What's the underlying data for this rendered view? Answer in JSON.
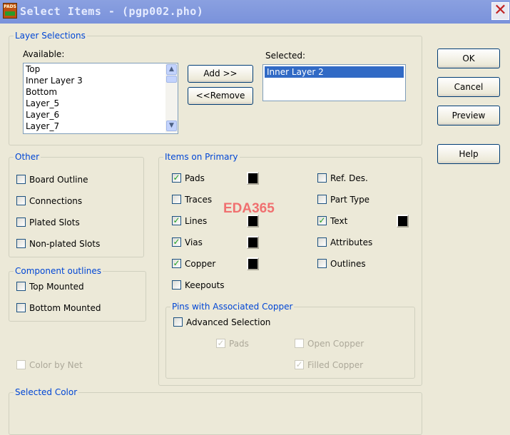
{
  "window": {
    "title": "Select Items - (pgp002.pho)",
    "icon_text": "PADS"
  },
  "layer_selections": {
    "legend": "Layer Selections",
    "available_label": "Available:",
    "selected_label": "Selected:",
    "available": [
      "Top",
      "Inner Layer 3",
      "Bottom",
      "Layer_5",
      "Layer_6",
      "Layer_7"
    ],
    "selected": [
      "Inner Layer 2"
    ],
    "add_label": "Add >>",
    "remove_label": "<<Remove"
  },
  "buttons": {
    "ok": "OK",
    "cancel": "Cancel",
    "preview": "Preview",
    "help": "Help"
  },
  "other": {
    "legend": "Other",
    "items": [
      {
        "label": "Board Outline",
        "checked": false
      },
      {
        "label": "Connections",
        "checked": false
      },
      {
        "label": "Plated Slots",
        "checked": false
      },
      {
        "label": "Non-plated Slots",
        "checked": false
      }
    ]
  },
  "component_outlines": {
    "legend": "Component outlines",
    "items": [
      {
        "label": "Top Mounted",
        "checked": false
      },
      {
        "label": "Bottom Mounted",
        "checked": false
      }
    ]
  },
  "color_by_net": {
    "label": "Color by Net",
    "checked": false,
    "disabled": true
  },
  "items_on_primary": {
    "legend": "Items on Primary",
    "left": [
      {
        "label": "Pads",
        "checked": true,
        "color": "#000000"
      },
      {
        "label": "Traces",
        "checked": false
      },
      {
        "label": "Lines",
        "checked": true,
        "color": "#000000"
      },
      {
        "label": "Vias",
        "checked": true,
        "color": "#000000"
      },
      {
        "label": "Copper",
        "checked": true,
        "color": "#000000"
      },
      {
        "label": "Keepouts",
        "checked": false
      }
    ],
    "right": [
      {
        "label": "Ref. Des.",
        "checked": false
      },
      {
        "label": "Part Type",
        "checked": false
      },
      {
        "label": "Text",
        "checked": true,
        "color": "#000000"
      },
      {
        "label": "Attributes",
        "checked": false
      },
      {
        "label": "Outlines",
        "checked": false
      }
    ]
  },
  "pins": {
    "legend": "Pins with Associated Copper",
    "advanced": {
      "label": "Advanced Selection",
      "checked": false
    },
    "pads": {
      "label": "Pads",
      "checked": true
    },
    "open_copper": {
      "label": "Open Copper",
      "checked": false
    },
    "filled_copper": {
      "label": "Filled Copper",
      "checked": true
    }
  },
  "selected_color": {
    "legend": "Selected Color"
  },
  "watermark": "EDA365"
}
